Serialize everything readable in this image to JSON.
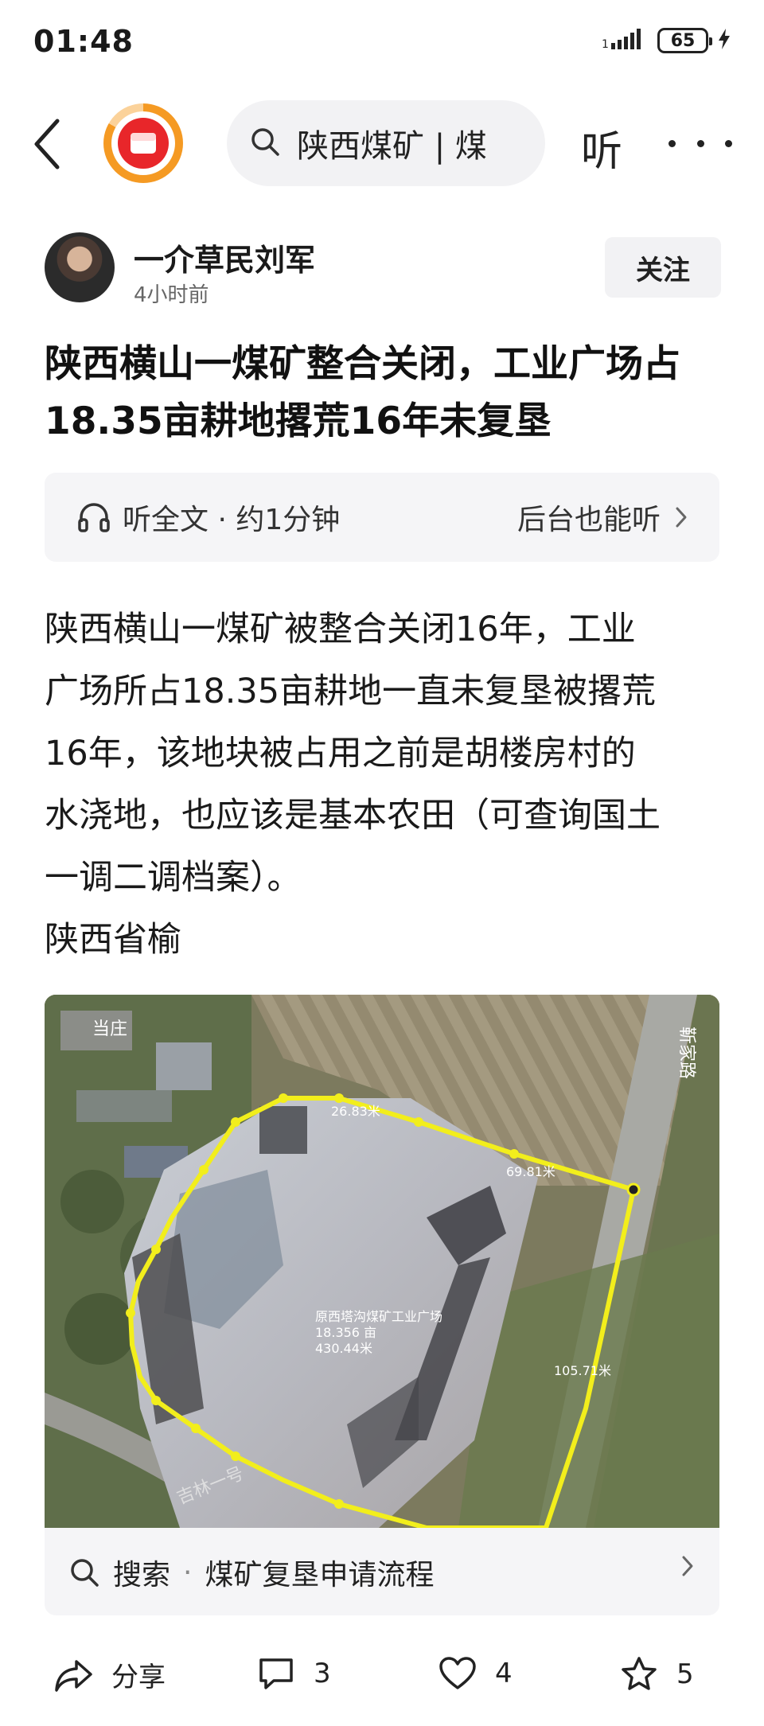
{
  "status_bar": {
    "time": "01:48",
    "signal_text": "1",
    "battery": "65"
  },
  "nav": {
    "search_text": "陕西煤矿 | 煤",
    "listen_label": "听"
  },
  "author": {
    "name": "一介草民刘军",
    "time": "4小时前",
    "follow_label": "关注"
  },
  "article": {
    "title_line1": "陕西横山一煤矿整合关闭，工业广场占",
    "title_line2": "18.35亩耕地撂荒16年未复垦",
    "listen_full": "听全文 · 约1分钟",
    "background_listen": "后台也能听",
    "body_lines": [
      "陕西横山一煤矿被整合关闭16年，工业",
      "广场所占18.35亩耕地一直未复垦被撂荒",
      "16年，该地块被占用之前是胡楼房村的",
      "水浇地，也应该是基本农田（可查询国土",
      "一调二调档案）。"
    ],
    "location_line": "陕西省榆"
  },
  "map_image": {
    "label_village": "当庄",
    "label_site": "原西塔沟煤矿工业广场",
    "label_area": "18.356 亩",
    "label_perimeter": "430.44米",
    "label_top": "26.83米",
    "label_right_top": "69.81米",
    "label_right": "105.71米",
    "label_road_bottom": "吉林一号",
    "label_road_right": "靳家路"
  },
  "search_suggestion": {
    "prefix": "搜索",
    "dot": "·",
    "query": "煤矿复垦申请流程"
  },
  "actions": {
    "share": "分享",
    "comments": "3",
    "likes": "4",
    "favorites": "5"
  },
  "colors": {
    "accent_red": "#e8262a",
    "accent_orange": "#f59a23",
    "boundary_yellow": "#f2ee1c"
  }
}
